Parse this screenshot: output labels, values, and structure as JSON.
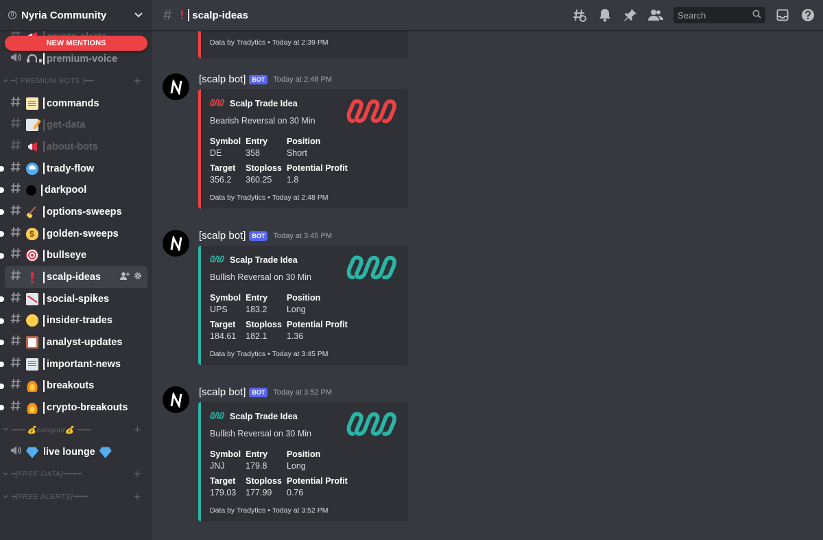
{
  "server": {
    "name": "Nyria Community",
    "badge": "0"
  },
  "new_mentions": "NEW MENTIONS",
  "sidebar": {
    "top_channels": [
      {
        "label": "crypto-alerts",
        "emoji": "mega",
        "kind": "text",
        "state": "muted"
      },
      {
        "label": "premium-voice",
        "emoji": "headphones",
        "kind": "voice",
        "state": "normal"
      }
    ],
    "category_premium": "━[ PREMIUM BOTS ]━━",
    "premium_channels": [
      {
        "label": "commands",
        "emoji": "scroll",
        "state": "unread",
        "dot": false
      },
      {
        "label": "get-data",
        "emoji": "memo",
        "state": "muted",
        "dot": false
      },
      {
        "label": "about-bots",
        "emoji": "mega",
        "state": "muted",
        "dot": false
      },
      {
        "label": "trady-flow",
        "emoji": "wave",
        "state": "unread",
        "dot": true
      },
      {
        "label": "darkpool",
        "emoji": "black",
        "state": "unread",
        "dot": true
      },
      {
        "label": "options-sweeps",
        "emoji": "broom",
        "state": "unread",
        "dot": true
      },
      {
        "label": "golden-sweeps",
        "emoji": "money",
        "state": "unread",
        "dot": true
      },
      {
        "label": "bullseye",
        "emoji": "target",
        "state": "unread",
        "dot": true
      },
      {
        "label": "scalp-ideas",
        "emoji": "excl",
        "state": "active",
        "dot": false
      },
      {
        "label": "social-spikes",
        "emoji": "chart",
        "state": "unread",
        "dot": true
      },
      {
        "label": "insider-trades",
        "emoji": "yellow",
        "state": "unread",
        "dot": true
      },
      {
        "label": "analyst-updates",
        "emoji": "clip",
        "state": "unread",
        "dot": true
      },
      {
        "label": "important-news",
        "emoji": "news",
        "state": "unread",
        "dot": true
      },
      {
        "label": "breakouts",
        "emoji": "fire",
        "state": "unread",
        "dot": true
      },
      {
        "label": "crypto-breakouts",
        "emoji": "fire",
        "state": "unread",
        "dot": true
      }
    ],
    "category_hangout": "━━━ 💰hangout💰 ━━━",
    "hangout_channels": [
      {
        "label": "live lounge",
        "emoji": "diamond",
        "kind": "voice"
      }
    ],
    "category_free_data": "━[FREE DATA]━━━━",
    "category_free_alerts": "━[FREE ALERTS]━━━"
  },
  "topbar": {
    "channel": "scalp-ideas",
    "search_placeholder": "Search",
    "icons": [
      "threads-icon",
      "bell-icon",
      "pin-icon",
      "members-icon"
    ]
  },
  "messages": {
    "partial_footer": {
      "source": "Data by Tradytics",
      "time": "Today at 2:39 PM"
    },
    "items": [
      {
        "user": "[scalp bot]",
        "tag": "BOT",
        "time": "Today at 2:48 PM",
        "sentiment": "bear",
        "color": "#ed4245",
        "author": "Scalp Trade Idea",
        "description": "Bearish Reversal on 30 Min",
        "fields": [
          {
            "name": "Symbol",
            "value": "DE"
          },
          {
            "name": "Entry",
            "value": "358"
          },
          {
            "name": "Position",
            "value": "Short"
          },
          {
            "name": "Target",
            "value": "356.2"
          },
          {
            "name": "Stoploss",
            "value": "360.25"
          },
          {
            "name": "Potential Profit",
            "value": "1.8"
          }
        ],
        "footer": {
          "source": "Data by Tradytics",
          "time": "Today at 2:48 PM"
        }
      },
      {
        "user": "[scalp bot]",
        "tag": "BOT",
        "time": "Today at 3:45 PM",
        "sentiment": "bull",
        "color": "#2ab6a6",
        "author": "Scalp Trade Idea",
        "description": "Bullish Reversal on 30 Min",
        "fields": [
          {
            "name": "Symbol",
            "value": "UPS"
          },
          {
            "name": "Entry",
            "value": "183.2"
          },
          {
            "name": "Position",
            "value": "Long"
          },
          {
            "name": "Target",
            "value": "184.61"
          },
          {
            "name": "Stoploss",
            "value": "182.1"
          },
          {
            "name": "Potential Profit",
            "value": "1.36"
          }
        ],
        "footer": {
          "source": "Data by Tradytics",
          "time": "Today at 3:45 PM"
        }
      },
      {
        "user": "[scalp bot]",
        "tag": "BOT",
        "time": "Today at 3:52 PM",
        "sentiment": "bull",
        "color": "#2ab6a6",
        "author": "Scalp Trade Idea",
        "description": "Bullish Reversal on 30 Min",
        "fields": [
          {
            "name": "Symbol",
            "value": "JNJ"
          },
          {
            "name": "Entry",
            "value": "179.8"
          },
          {
            "name": "Position",
            "value": "Long"
          },
          {
            "name": "Target",
            "value": "179.03"
          },
          {
            "name": "Stoploss",
            "value": "177.99"
          },
          {
            "name": "Potential Profit",
            "value": "0.76"
          }
        ],
        "footer": {
          "source": "Data by Tradytics",
          "time": "Today at 3:52 PM"
        }
      }
    ]
  }
}
